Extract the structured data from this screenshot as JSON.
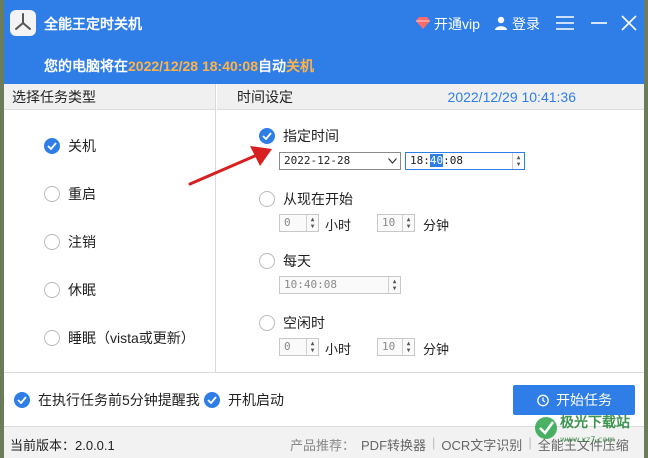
{
  "titlebar": {
    "app_title": "全能王定时关机",
    "vip_label": "开通vip",
    "login_label": "登录",
    "shutdown_prefix": "您的电脑将在",
    "shutdown_time": "2022/12/28 18:40:08",
    "shutdown_mid": "自动",
    "shutdown_action": "关机",
    "colors": {
      "bar": "#2f7ee8",
      "highlight": "#ffb347"
    }
  },
  "left": {
    "header": "选择任务类型",
    "options": [
      {
        "label": "关机",
        "checked": true
      },
      {
        "label": "重启",
        "checked": false
      },
      {
        "label": "注销",
        "checked": false
      },
      {
        "label": "休眠",
        "checked": false
      },
      {
        "label": "睡眠（vista或更新）",
        "checked": false
      }
    ]
  },
  "right": {
    "header": "时间设定",
    "current_time": "2022/12/29 10:41:36",
    "specify": {
      "label": "指定时间",
      "checked": true,
      "date": "2022-12-28",
      "time_h": "18:",
      "time_m": "40",
      "time_s": ":08"
    },
    "from_now": {
      "label": "从现在开始",
      "checked": false,
      "hours": "0",
      "hours_unit": "小时",
      "minutes": "10",
      "minutes_unit": "分钟"
    },
    "daily": {
      "label": "每天",
      "checked": false,
      "time": "10:40:08"
    },
    "idle": {
      "label": "空闲时",
      "checked": false,
      "hours": "0",
      "hours_unit": "小时",
      "minutes": "10",
      "minutes_unit": "分钟"
    }
  },
  "bottom": {
    "remind_label": "在执行任务前5分钟提醒我",
    "autostart_label": "开机启动",
    "start_button": "开始任务"
  },
  "status": {
    "version": "当前版本：2.0.0.1",
    "recommend": "产品推荐：",
    "products": [
      "PDF转换器",
      "OCR文字识别",
      "全能王文件压缩"
    ]
  },
  "watermark": {
    "text": "极光下载站"
  }
}
